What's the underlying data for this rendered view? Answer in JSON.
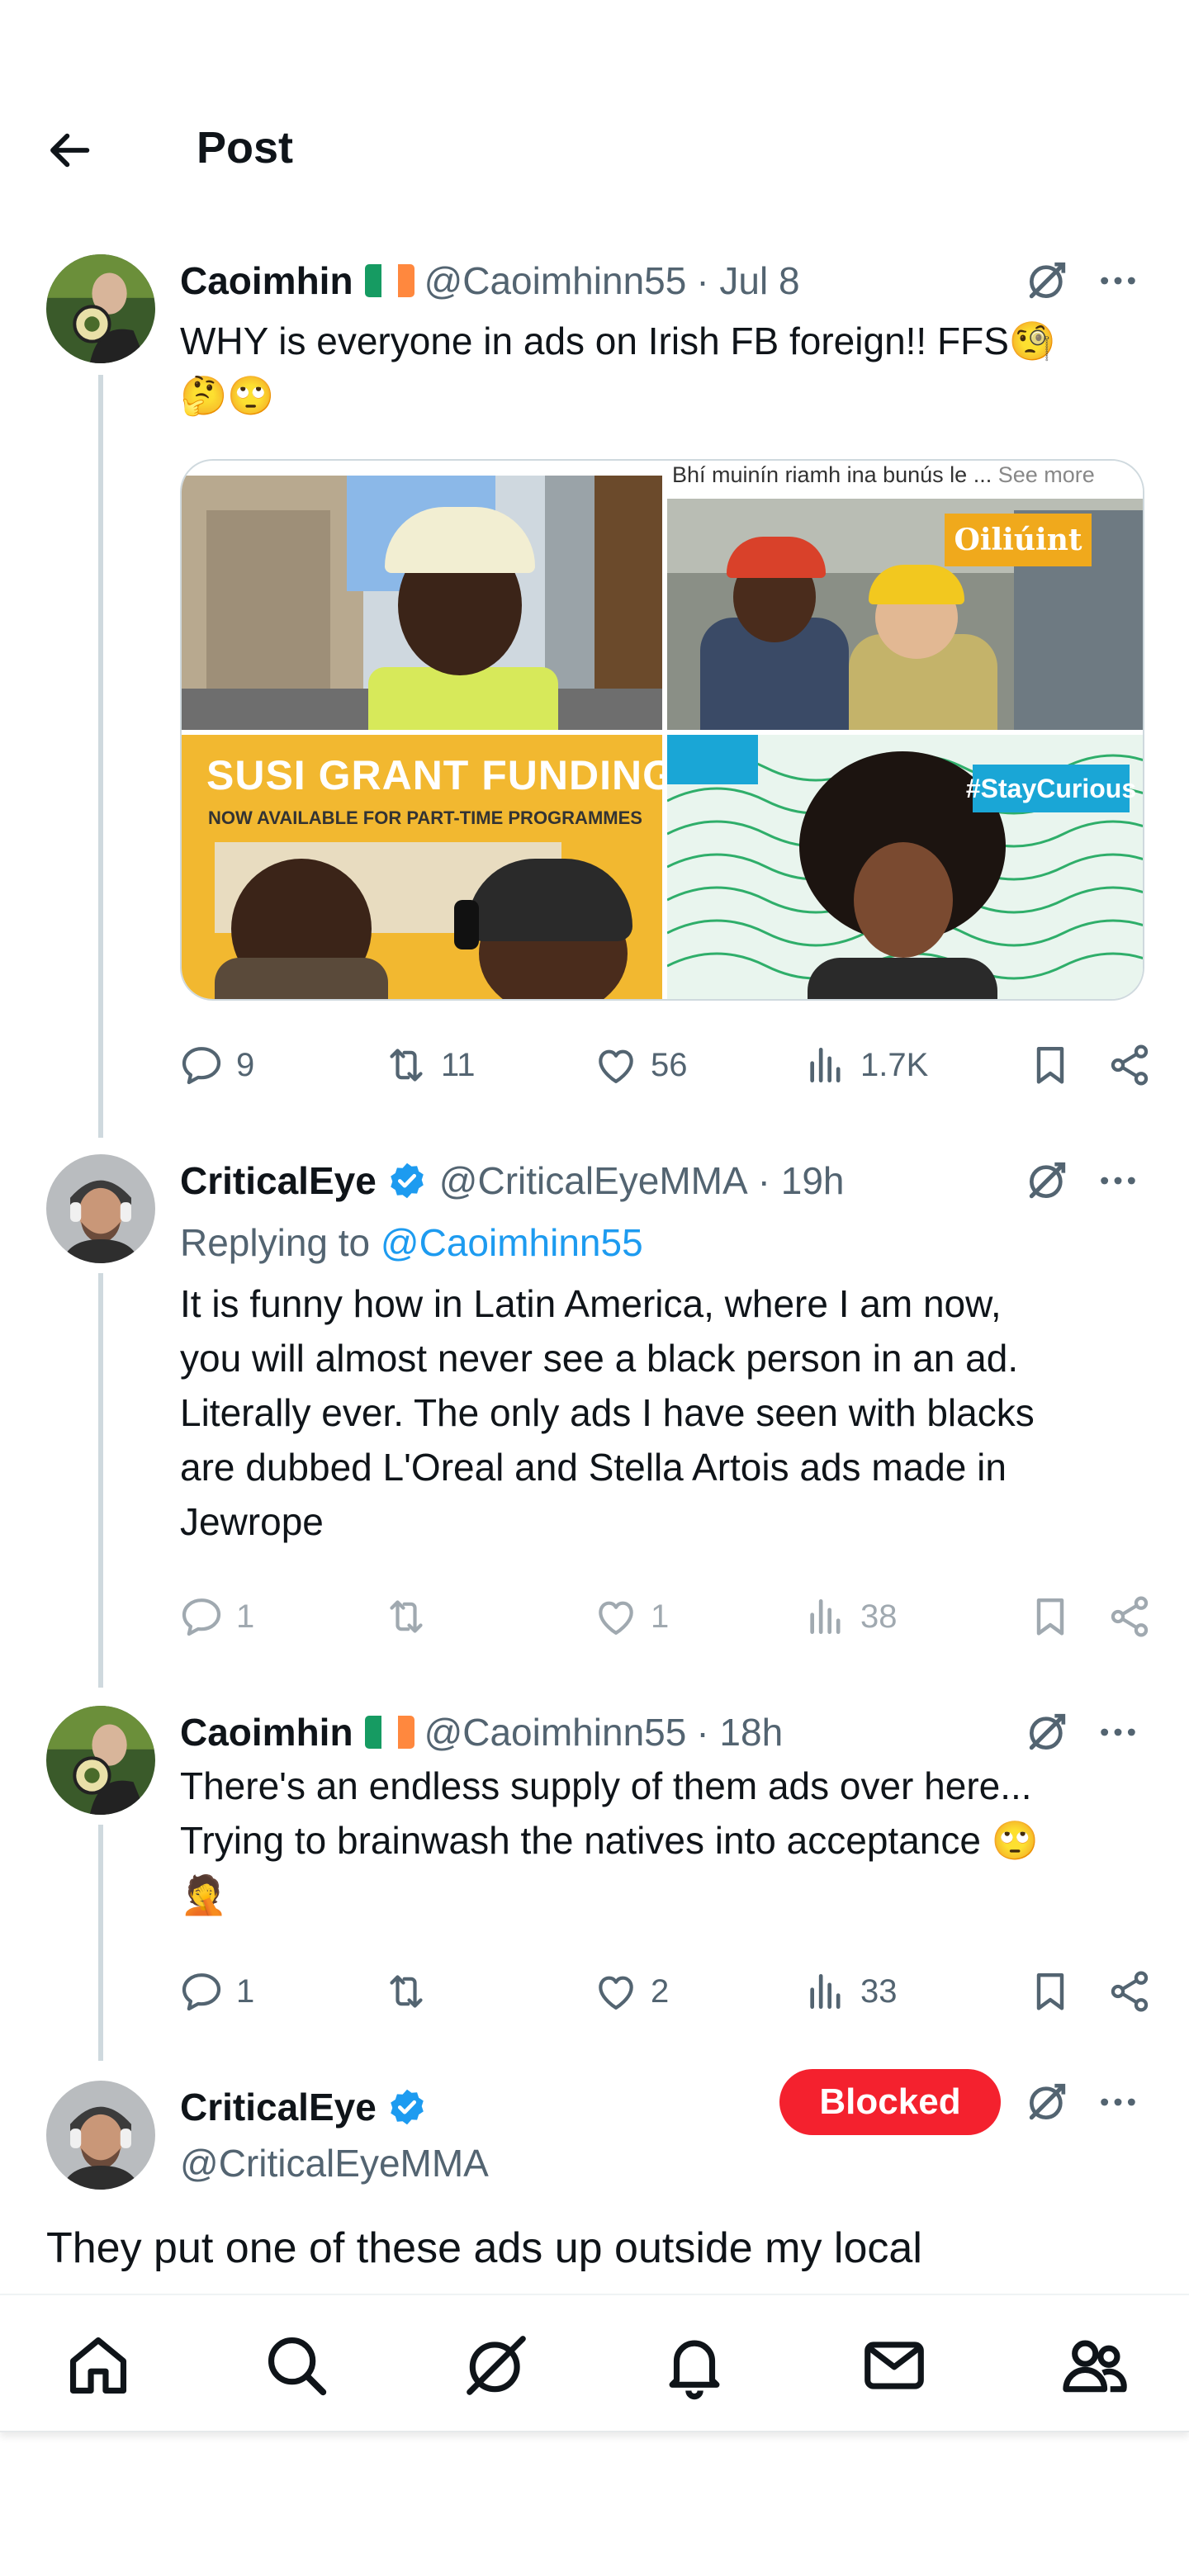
{
  "header": {
    "title": "Post"
  },
  "tweets": [
    {
      "name": "Caoimhin",
      "handle": "@Caoimhinn55",
      "time": "· Jul 8",
      "text_lines": [
        "WHY is everyone in ads on Irish FB foreign!! FFS🧐",
        "🤔🙄"
      ],
      "media": {
        "top_right_caption": "Bhí muinín riamh ina bunús le ...",
        "see_more": "See more",
        "badge_top_right": "Oiliúint",
        "grant_title": "SUSI GRANT FUNDING",
        "grant_subtitle": "NOW AVAILABLE FOR PART-TIME PROGRAMMES",
        "hashtag": "#StayCurious"
      },
      "stats": {
        "replies": "9",
        "reposts": "11",
        "likes": "56",
        "views": "1.7K"
      }
    },
    {
      "name": "CriticalEye",
      "handle": "@CriticalEyeMMA",
      "time": "· 19h",
      "replying_prefix": "Replying to",
      "replying_to": "@Caoimhinn55",
      "text_lines": [
        "It is funny how in Latin America, where I am now,",
        "you will almost never see a black person in an ad.",
        "Literally ever. The only ads I have seen with blacks",
        "are dubbed L'Oreal and Stella Artois ads made in",
        "Jewrope"
      ],
      "stats": {
        "replies": "1",
        "reposts": "",
        "likes": "1",
        "views": "38"
      }
    },
    {
      "name": "Caoimhin",
      "handle": "@Caoimhinn55",
      "time": "· 18h",
      "text_lines": [
        "There's an endless supply of them ads over here...",
        "Trying to brainwash the natives into acceptance 🙄",
        "🤦"
      ],
      "stats": {
        "replies": "1",
        "reposts": "",
        "likes": "2",
        "views": "33"
      }
    },
    {
      "name": "CriticalEye",
      "handle": "@CriticalEyeMMA",
      "blocked_label": "Blocked",
      "text_lines": [
        "They put one of these ads up outside my local"
      ]
    }
  ],
  "colors": {
    "accent": "#1d9bf0",
    "blocked": "#f4212e",
    "secondary_text": "#536471"
  },
  "icons": [
    "back-arrow-icon",
    "grok-icon",
    "more-icon",
    "reply-icon",
    "repost-icon",
    "like-icon",
    "views-icon",
    "bookmark-icon",
    "share-icon",
    "verified-badge-icon",
    "ireland-flag-icon",
    "home-icon",
    "search-icon",
    "grok-nav-icon",
    "notifications-icon",
    "messages-icon",
    "communities-icon"
  ]
}
